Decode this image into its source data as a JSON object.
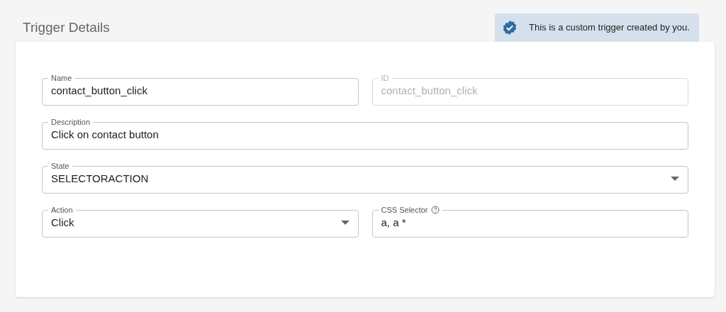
{
  "title": "Trigger Details",
  "banner": {
    "text": "This is a custom trigger created by you."
  },
  "rows": [
    [
      {
        "kind": "text",
        "label": "Name",
        "value": "contact_button_click",
        "disabled": false,
        "help": false
      },
      {
        "kind": "text",
        "label": "ID",
        "value": "contact_button_click",
        "disabled": true,
        "help": false
      }
    ],
    [
      {
        "kind": "text",
        "label": "Description",
        "value": "Click on contact button",
        "disabled": false,
        "help": false
      }
    ],
    [
      {
        "kind": "select",
        "label": "State",
        "value": "SELECTORACTION",
        "disabled": false,
        "help": false
      }
    ],
    [
      {
        "kind": "select",
        "label": "Action",
        "value": "Click",
        "disabled": false,
        "help": false
      },
      {
        "kind": "text",
        "label": "CSS Selector",
        "value": "a, a *",
        "disabled": false,
        "help": true
      }
    ]
  ]
}
